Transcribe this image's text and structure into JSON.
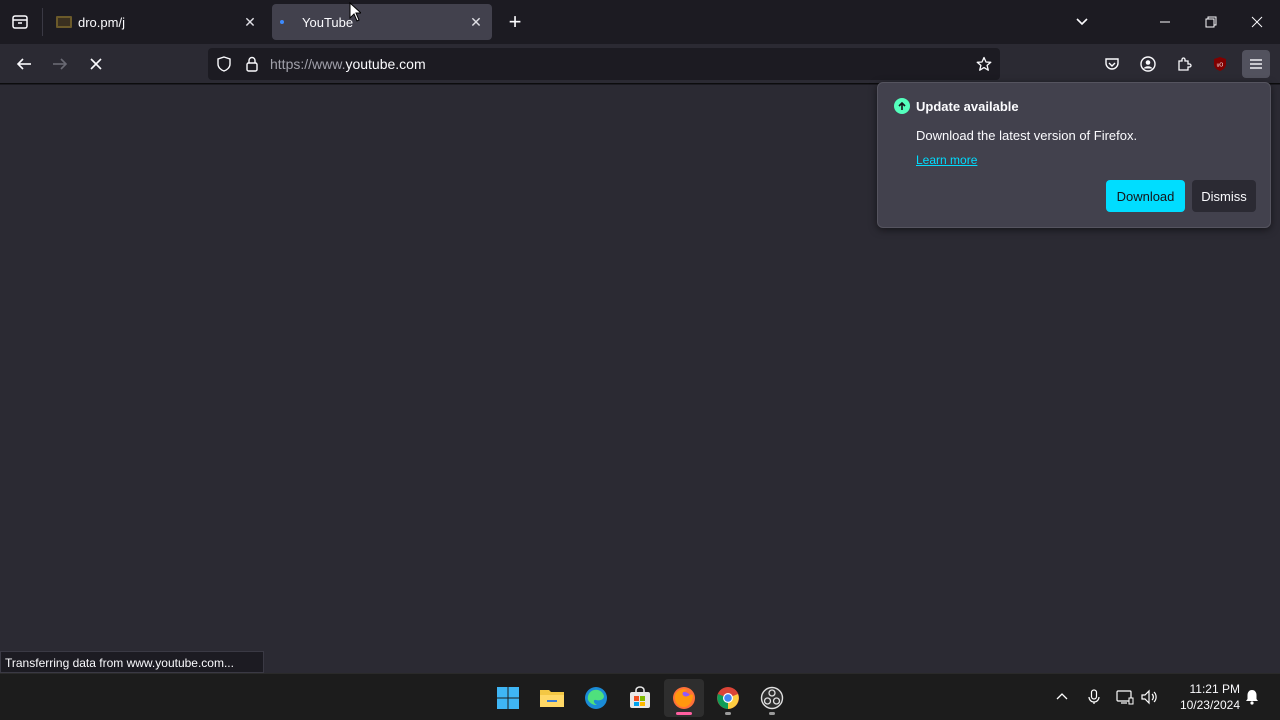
{
  "tabs": [
    {
      "title": "dro.pm/j",
      "close": "✕"
    },
    {
      "title": "YouTube",
      "close": "✕"
    }
  ],
  "new_tab_label": "+",
  "url": {
    "prefix": "https://www.",
    "domain": "youtube.com"
  },
  "update_panel": {
    "title": "Update available",
    "message": "Download the latest version of Firefox.",
    "learn_more": "Learn more",
    "download_label": "Download",
    "dismiss_label": "Dismiss"
  },
  "status_text": "Transferring data from www.youtube.com...",
  "clock": {
    "time": "11:21 PM",
    "date": "10/23/2024"
  },
  "colors": {
    "accent": "#00ddff",
    "update_icon": "#54ffbd",
    "ublock": "#800000"
  },
  "icons": {
    "tab_list": "firefox-view-icon",
    "back": "back-arrow-icon",
    "forward": "forward-arrow-icon",
    "stop": "stop-icon",
    "shield": "tracking-protection-icon",
    "lock": "lock-icon",
    "star": "bookmark-star-icon",
    "pocket": "pocket-icon",
    "account": "account-icon",
    "extensions": "extensions-icon",
    "ublock": "ublock-origin-icon",
    "menu": "hamburger-menu-icon"
  }
}
